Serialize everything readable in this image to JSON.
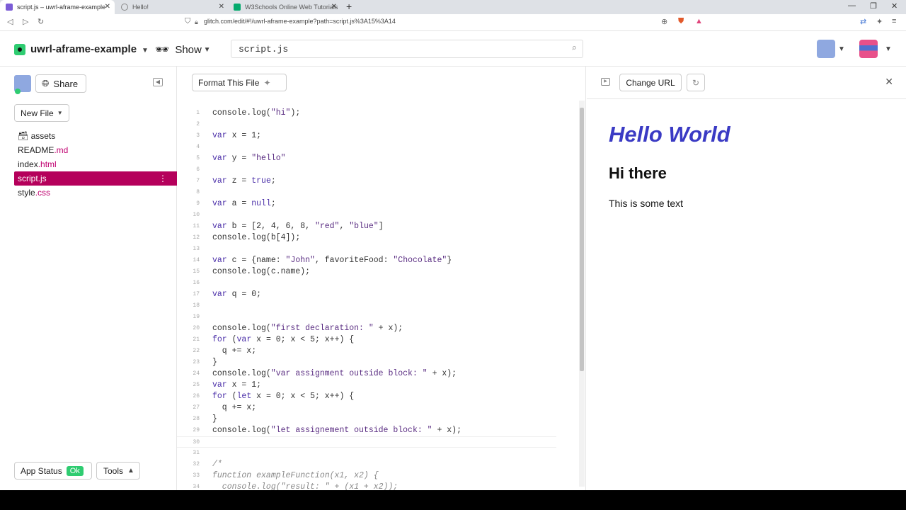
{
  "browser": {
    "tabs": [
      {
        "title": "script.js – uwrl-aframe-example",
        "active": true
      },
      {
        "title": "Hello!",
        "active": false
      },
      {
        "title": "W3Schools Online Web Tutorials",
        "active": false
      }
    ],
    "url": "glitch.com/edit/#!/uwrl-aframe-example?path=script.js%3A15%3A14"
  },
  "header": {
    "project_name": "uwrl-aframe-example",
    "show_label": "Show",
    "search_value": "script.js"
  },
  "sidebar": {
    "share_label": "Share",
    "new_file_label": "New File",
    "files": [
      {
        "name": "assets",
        "ext": ""
      },
      {
        "name": "README",
        "ext": ".md"
      },
      {
        "name": "index",
        "ext": ".html"
      },
      {
        "name": "script.js",
        "ext": ""
      },
      {
        "name": "style",
        "ext": ".css"
      }
    ],
    "selected_file": "script.js",
    "app_status_label": "App Status",
    "app_status_badge": "Ok",
    "tools_label": "Tools"
  },
  "editor": {
    "format_label": "Format This File",
    "lines": [
      "console.log(\"hi\");",
      "",
      "var x = 1;",
      "",
      "var y = \"hello\"",
      "",
      "var z = true;",
      "",
      "var a = null;",
      "",
      "var b = [2, 4, 6, 8, \"red\", \"blue\"]",
      "console.log(b[4]);",
      "",
      "var c = {name: \"John\", favoriteFood: \"Chocolate\"}",
      "console.log(c.name);",
      "",
      "var q = 0;",
      "",
      "",
      "console.log(\"first declaration: \" + x);",
      "for (var x = 0; x < 5; x++) {",
      "  q += x;",
      "}",
      "console.log(\"var assignment outside block: \" + x);",
      "var x = 1;",
      "for (let x = 0; x < 5; x++) {",
      "  q += x;",
      "}",
      "console.log(\"let assignement outside block: \" + x);",
      "",
      "",
      "/*",
      "function exampleFunction(x1, x2) {",
      "  console.log(\"result: \" + (x1 + x2));"
    ],
    "active_line": 30
  },
  "preview": {
    "change_url_label": "Change URL",
    "heading1": "Hello World",
    "heading2": "Hi there",
    "paragraph": "This is some text"
  }
}
